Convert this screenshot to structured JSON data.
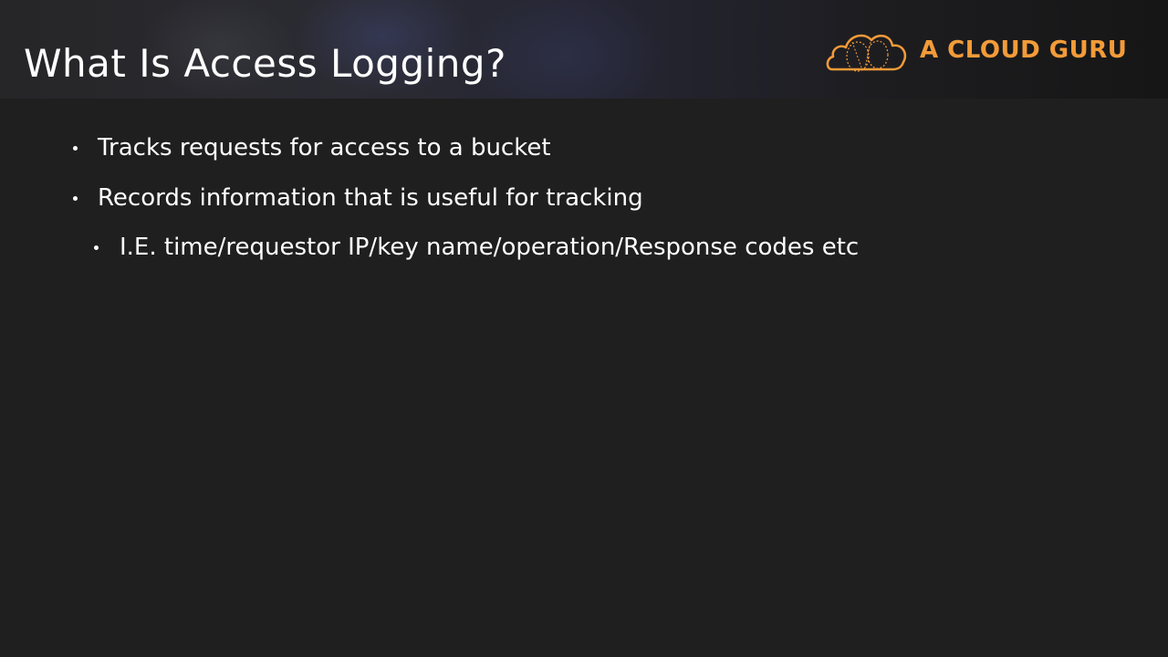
{
  "slide": {
    "title": "What Is Access Logging?",
    "brand": {
      "name": "A CLOUD GURU",
      "logo_icon": "cloud-guru-logo-icon",
      "color": "#f39b39"
    },
    "bullets": [
      {
        "level": 1,
        "text": "Tracks requests for access to a bucket"
      },
      {
        "level": 1,
        "text": "Records information that is useful for tracking"
      },
      {
        "level": 2,
        "text": "I.E. time/requestor IP/key name/operation/Response codes etc"
      }
    ]
  }
}
